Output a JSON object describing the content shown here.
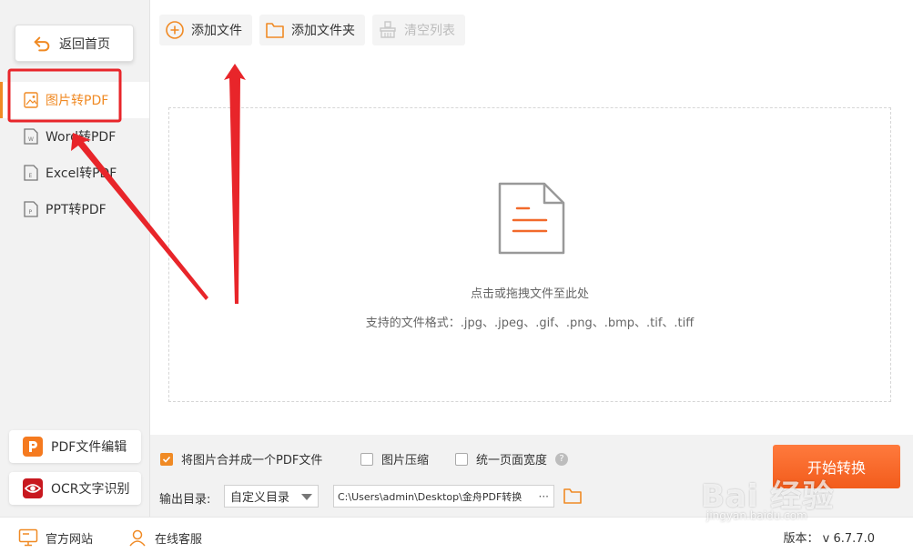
{
  "sidebar": {
    "back_label": "返回首页",
    "items": [
      {
        "label": "图片转PDF",
        "icon": "image-file-icon",
        "active": true
      },
      {
        "label": "Word转PDF",
        "icon": "word-file-icon",
        "active": false
      },
      {
        "label": "Excel转PDF",
        "icon": "excel-file-icon",
        "active": false
      },
      {
        "label": "PPT转PDF",
        "icon": "ppt-file-icon",
        "active": false
      }
    ],
    "tools": [
      {
        "label": "PDF文件编辑",
        "icon": "pdf-editor-icon"
      },
      {
        "label": "OCR文字识别",
        "icon": "ocr-eye-icon"
      }
    ]
  },
  "toolbar": {
    "add_file": "添加文件",
    "add_folder": "添加文件夹",
    "clear_list": "清空列表"
  },
  "dropzone": {
    "hint": "点击或拖拽文件至此处",
    "formats": "支持的文件格式：.jpg、.jpeg、.gif、.png、.bmp、.tif、.tiff"
  },
  "options": {
    "merge_label": "将图片合并成一个PDF文件",
    "merge_checked": true,
    "compress_label": "图片压缩",
    "compress_checked": false,
    "uniform_label": "统一页面宽度",
    "uniform_checked": false,
    "help": "?"
  },
  "output": {
    "label": "输出目录:",
    "select_value": "自定义目录",
    "path": "C:\\Users\\admin\\Desktop\\金舟PDF转换",
    "more": "···"
  },
  "start_label": "开始转换",
  "footer": {
    "website": "官方网站",
    "service": "在线客服",
    "version": "版本： v 6.7.7.0"
  },
  "watermark": {
    "main": "Bai 经验",
    "sub": "jingyan.baidu.com"
  },
  "colors": {
    "accent": "#f08a24",
    "start": "#f25c1c",
    "annotation": "#e8252a"
  }
}
